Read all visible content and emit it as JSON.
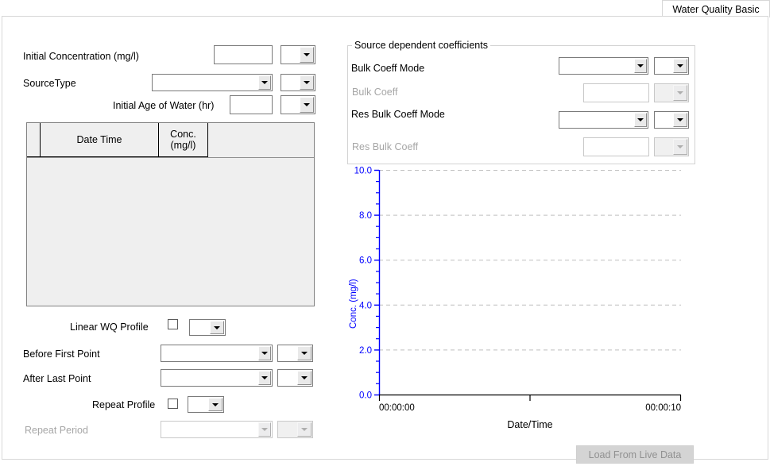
{
  "tabs": [
    {
      "label": "Water Quality Basic",
      "active": true
    }
  ],
  "left_panel": {
    "initial_concentration": {
      "label": "Initial Concentration (mg/l)",
      "value": "",
      "unit_value": ""
    },
    "source_type": {
      "label": "SourceType",
      "value": "",
      "unit_value": ""
    },
    "initial_age_of_water": {
      "label": "Initial Age of Water (hr)",
      "value": "",
      "unit_value": ""
    },
    "table": {
      "columns": [
        "",
        "Date Time",
        "Conc.\n(mg/l)"
      ],
      "column_selector": "",
      "column_datetime": "Date Time",
      "column_conc_line1": "Conc.",
      "column_conc_line2": "(mg/l)",
      "rows": []
    },
    "linear_wq_profile": {
      "label": "Linear WQ Profile",
      "checked": false,
      "value": ""
    },
    "before_first_point": {
      "label": "Before First Point",
      "value": "",
      "unit_value": ""
    },
    "after_last_point": {
      "label": "After Last Point",
      "value": "",
      "unit_value": ""
    },
    "repeat_profile": {
      "label": "Repeat Profile",
      "checked": false,
      "value": ""
    },
    "repeat_period": {
      "label": "Repeat Period",
      "value": "",
      "unit_value": "",
      "enabled": false
    }
  },
  "right_panel": {
    "group_title": "Source dependent coefficients",
    "bulk_coeff_mode": {
      "label": "Bulk Coeff Mode",
      "value": "",
      "unit_value": "",
      "enabled": true
    },
    "bulk_coeff": {
      "label": "Bulk Coeff",
      "value": "",
      "unit_value": "",
      "enabled": false
    },
    "res_bulk_coeff_mode": {
      "label": "Res Bulk Coeff Mode",
      "value": "",
      "unit_value": "",
      "enabled": true
    },
    "res_bulk_coeff": {
      "label": "Res Bulk Coeff",
      "value": "",
      "unit_value": "",
      "enabled": false
    },
    "load_from_live_data_button": {
      "label": "Load From Live Data",
      "enabled": false
    }
  },
  "chart_data": {
    "type": "line",
    "title": "",
    "xlabel": "Date/Time",
    "ylabel": "Conc. (mg/l)",
    "ylim": [
      0.0,
      10.0
    ],
    "ytick_labels": [
      "10.0",
      "8.0",
      "6.0",
      "4.0",
      "2.0",
      "0.0"
    ],
    "ytick_values": [
      10.0,
      8.0,
      6.0,
      4.0,
      2.0,
      0.0
    ],
    "xtick_labels": [
      "00:00:00",
      "00:00:10"
    ],
    "xtick_values": [
      "00:00:00",
      "00:00:10"
    ],
    "grid": true,
    "grid_orientation": "horizontal",
    "legend": false,
    "series": [],
    "axis_color": "#0000ff",
    "grid_color": "#bfbfbf",
    "plot_background": "#ffffff"
  }
}
